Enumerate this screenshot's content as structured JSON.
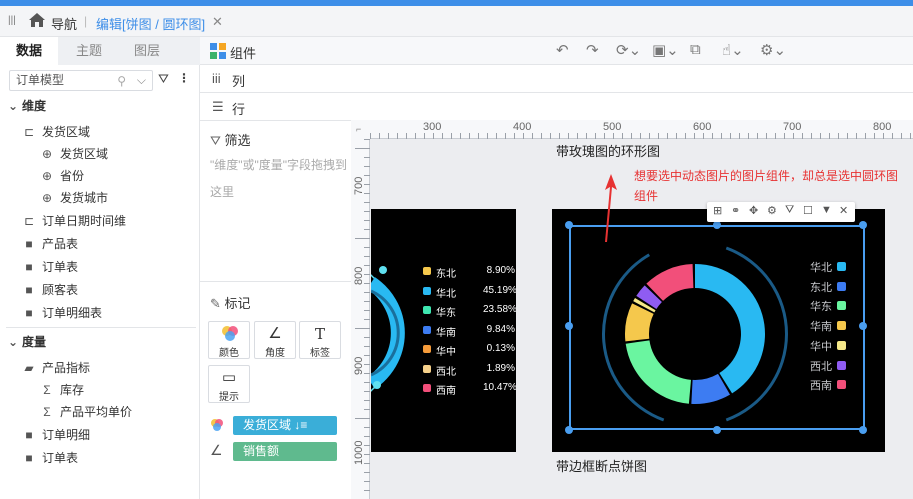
{
  "tabs": {
    "nav": "导航",
    "editing": "编辑[饼图 / 圆环图]"
  },
  "left_panel": {
    "tabs": [
      "数据",
      "主题",
      "图层"
    ],
    "model_select": "订单模型",
    "dimension_title": "维度",
    "dimensions": [
      {
        "label": "发货区域",
        "level": 0
      },
      {
        "label": "发货区域",
        "level": 1
      },
      {
        "label": "省份",
        "level": 1
      },
      {
        "label": "发货城市",
        "level": 1
      },
      {
        "label": "订单日期时间维",
        "level": 0
      },
      {
        "label": "产品表",
        "level": 0
      },
      {
        "label": "订单表",
        "level": 0
      },
      {
        "label": "顾客表",
        "level": 0
      },
      {
        "label": "订单明细表",
        "level": 0
      }
    ],
    "measure_title": "度量",
    "measures": [
      {
        "label": "产品指标",
        "level": 0
      },
      {
        "label": "库存",
        "level": 1
      },
      {
        "label": "产品平均单价",
        "level": 1
      },
      {
        "label": "订单明细",
        "level": 0
      },
      {
        "label": "订单表",
        "level": 0
      }
    ]
  },
  "header": {
    "component_label": "组件",
    "columns_label": "列",
    "rows_label": "行"
  },
  "middle_panel": {
    "filter_title": "筛选",
    "filter_hint": "\"维度\"或\"度量\"字段拖拽到这里",
    "marks_title": "标记",
    "marks": [
      "颜色",
      "角度",
      "标签",
      "提示"
    ],
    "color_field": "发货区域",
    "angle_field": "销售额"
  },
  "ruler": {
    "top": [
      "300",
      "400",
      "500",
      "600",
      "700",
      "800"
    ],
    "left": [
      "700",
      "800",
      "900",
      "1000"
    ]
  },
  "canvas": {
    "chart_top_title": "带玫瑰图的环形图",
    "chart_bottom_title": "带边框断点饼图",
    "annotation": "想要选中动态图片的图片组件，却总是选中圆环图组件",
    "left_legend": [
      {
        "name": "东北",
        "value": "8.90%",
        "color": "#f5c84c"
      },
      {
        "name": "华北",
        "value": "45.19%",
        "color": "#29b9f2"
      },
      {
        "name": "华东",
        "value": "23.58%",
        "color": "#3ee6b0"
      },
      {
        "name": "华南",
        "value": "9.84%",
        "color": "#3d7cf2"
      },
      {
        "name": "华中",
        "value": "0.13%",
        "color": "#f59b3a"
      },
      {
        "name": "西北",
        "value": "1.89%",
        "color": "#f5d08a"
      },
      {
        "name": "西南",
        "value": "10.47%",
        "color": "#f24f7a"
      }
    ],
    "right_legend": [
      {
        "name": "华北",
        "color": "#29b9f2"
      },
      {
        "name": "东北",
        "color": "#3d7cf2"
      },
      {
        "name": "华东",
        "color": "#6af5a0"
      },
      {
        "name": "华南",
        "color": "#f5c84c"
      },
      {
        "name": "华中",
        "color": "#f5e889"
      },
      {
        "name": "西北",
        "color": "#8f5cf2"
      },
      {
        "name": "西南",
        "color": "#f24f7a"
      }
    ]
  },
  "colors": {
    "accent": "#3d8ee8",
    "selection": "#4a9ef0",
    "pill_color": "#3aaed8",
    "pill_angle": "#5fba8e",
    "annotation": "#e73232"
  }
}
